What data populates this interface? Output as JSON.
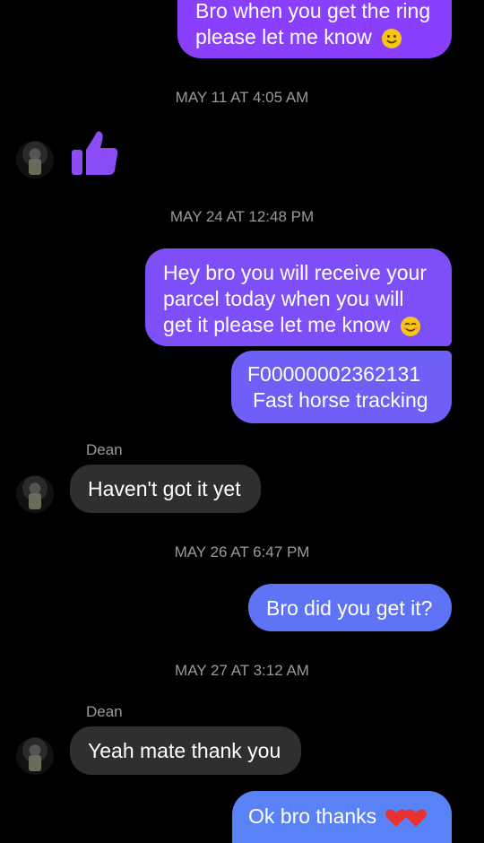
{
  "colors": {
    "outgoing_purple": "#8a3ffc",
    "outgoing_violet": "#7a55f7",
    "outgoing_blue": "#5f73f6",
    "incoming_gray": "#2f2f2f",
    "timestamp_gray": "#9a9a9a",
    "like_purple": "#8b4cf8"
  },
  "messages": {
    "m1": {
      "line1": "Bro when you get the ring",
      "line2": "please let me know",
      "emoji": "slightly-smiling-face"
    },
    "ts1": "MAY 11 AT 4:05 AM",
    "like": {
      "icon": "thumbs-up-icon"
    },
    "ts2": "MAY 24 AT 12:48 PM",
    "m2": {
      "line1": "Hey bro you will receive your",
      "line2": "parcel today when you will",
      "line3": "get it please let me know",
      "emoji": "smiling-face"
    },
    "m3": {
      "line1": "F00000002362131",
      "line2": "Fast horse tracking"
    },
    "sender1": "Dean",
    "m4": {
      "text": "Haven't got it yet"
    },
    "ts3": "MAY 26 AT 6:47 PM",
    "m5": {
      "text": "Bro did you get it?"
    },
    "ts4": "MAY 27 AT 3:12 AM",
    "sender2": "Dean",
    "m6": {
      "text": "Yeah mate thank you"
    },
    "m7": {
      "text": "Ok bro thanks",
      "emoji": "red-hearts"
    }
  }
}
